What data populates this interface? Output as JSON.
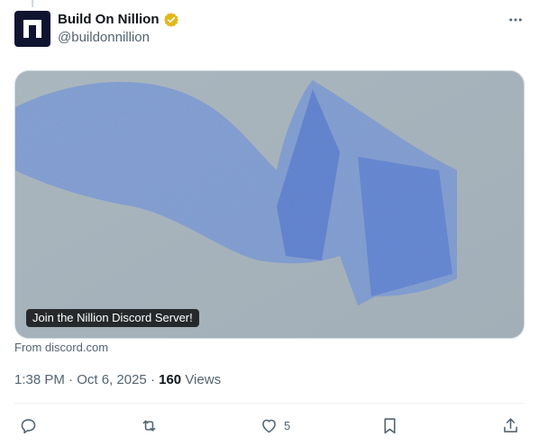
{
  "author": {
    "display_name": "Build On Nillion",
    "handle": "@buildonnillion",
    "verified_badge": "gold-verified-badge",
    "avatar_color": "#0f1430"
  },
  "card": {
    "label": "Join the Nillion Discord Server!",
    "source": "From discord.com",
    "image_description_colors": [
      "#a9b5bd",
      "#3b5fc4"
    ]
  },
  "meta": {
    "time": "1:38 PM",
    "date": "Oct 6, 2025",
    "views_count": "160",
    "views_label": "Views",
    "separator": "·"
  },
  "actions": {
    "reply_icon": "reply-icon",
    "repost_icon": "repost-icon",
    "like_icon": "heart-icon",
    "like_count": "5",
    "bookmark_icon": "bookmark-icon",
    "share_icon": "share-icon"
  },
  "colors": {
    "text_primary": "#0f1419",
    "text_secondary": "#536471",
    "border": "#cfd9de",
    "verified_gold": "#e2b719"
  }
}
